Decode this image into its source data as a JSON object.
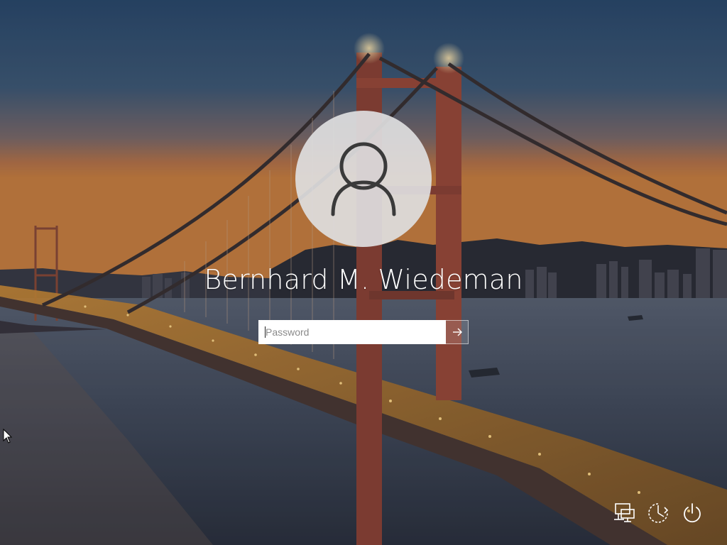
{
  "user": {
    "display_name": "Bernhard M. Wiedeman",
    "avatar_icon": "user-silhouette-icon"
  },
  "password": {
    "placeholder": "Password",
    "value": "",
    "submit_icon": "arrow-right-icon"
  },
  "corner_controls": [
    {
      "name": "network",
      "icon": "network-icon"
    },
    {
      "name": "ease-of-access",
      "icon": "ease-of-access-icon"
    },
    {
      "name": "power",
      "icon": "power-icon"
    }
  ],
  "colors": {
    "text": "#ffffff",
    "avatar_bg": "#dedee0",
    "avatar_icon": "#3a3a3a",
    "input_bg": "#ffffff"
  }
}
